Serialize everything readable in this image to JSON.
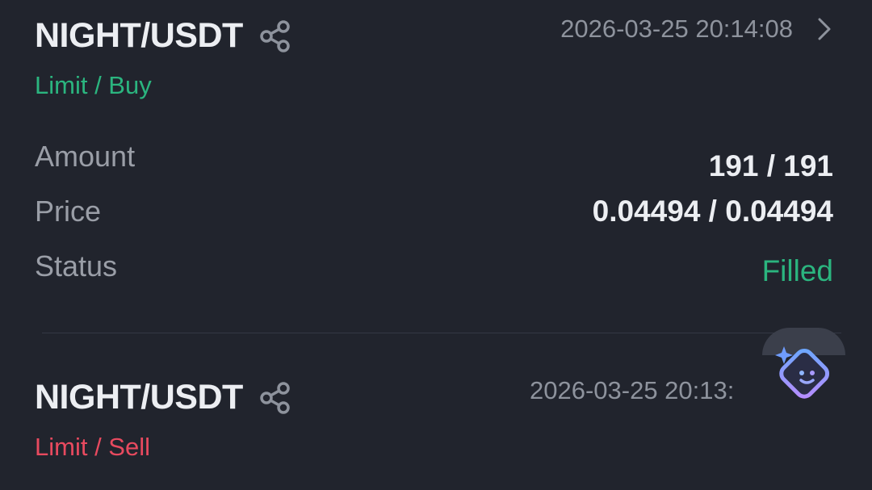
{
  "orders": [
    {
      "pair": "NIGHT/USDT",
      "timestamp": "2026-03-25 20:14:08",
      "side": "Limit / Buy",
      "amount_label": "Amount",
      "amount_value": "191 / 191",
      "price_label": "Price",
      "price_value": "0.04494 / 0.04494",
      "status_label": "Status",
      "status_value": "Filled"
    },
    {
      "pair": "NIGHT/USDT",
      "timestamp": "2026-03-25 20:13:",
      "side": "Limit / Sell"
    }
  ],
  "icons": {
    "share": "share-icon",
    "chevron": "chevron-right-icon",
    "assistant": "ai-assistant-icon"
  },
  "colors": {
    "background": "#21242d",
    "buy": "#2bb57f",
    "sell": "#e84a5f",
    "text_primary": "#eceef2",
    "text_secondary": "#8e939d"
  }
}
